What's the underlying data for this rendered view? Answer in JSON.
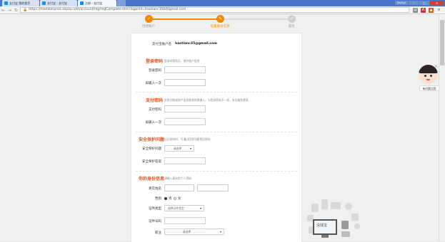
{
  "browser": {
    "tabs": [
      {
        "label": "支付宝 我的首页"
      },
      {
        "label": "支付宝 - 支付宝"
      },
      {
        "label": "注册 - 支付宝"
      }
    ],
    "window_buttons": {
      "minimize": "–",
      "maximize": "□",
      "close": "✕",
      "user": "Zephyr"
    },
    "url": "https://memberprod.alipay.com/account/reg/regComplete.htm?logonId=haotianc35640gmail.com",
    "colors": {
      "accent": "#f08a00",
      "chrome": "#4a76c9"
    }
  },
  "steps": [
    {
      "label": "创建账户",
      "icon": "checkmark-icon",
      "state": "done"
    },
    {
      "label": "设置身份信息",
      "icon": "edit-icon",
      "state": "current"
    },
    {
      "label": "成功",
      "icon": "checkmark-icon",
      "state": "pending"
    }
  ],
  "form": {
    "account_label": "支付宝账户名",
    "account_value": "haotianc35@gmail.com",
    "login_pw": {
      "title": "登录密码",
      "hint": "登录时需验证，保护账户信息",
      "fields": [
        "登录密码",
        "再输入一次"
      ]
    },
    "pay_pw": {
      "title": "支付密码",
      "hint": "交易付款或账户信息更改时需输入，与登录密码不一样，安全级别更高",
      "fields": [
        "支付密码",
        "再输入一次"
      ]
    },
    "security_q": {
      "title": "安全保护问题",
      "hint": "忘记密码时，可通过回答问题找回密码",
      "question_label": "安全保护问题",
      "question_value": "- - - 请选择 - - -",
      "answer_label": "安全保护答案"
    },
    "identity": {
      "title": "你的身份信息",
      "hint": "请输入真实的个人资料",
      "name_label": "真实姓名",
      "gender_label": "性别",
      "gender_options": [
        "男",
        "女"
      ],
      "id_type_label": "证件类型",
      "id_type_value": "选择证件类型",
      "id_number_label": "证件号码",
      "occupation_label": "职业",
      "occupation_value": "- - - - - - - - 请选择 - - - - - - - -"
    }
  },
  "helper": {
    "label": "有问题点我",
    "close": "×",
    "illustration_text": "没钱宝"
  }
}
